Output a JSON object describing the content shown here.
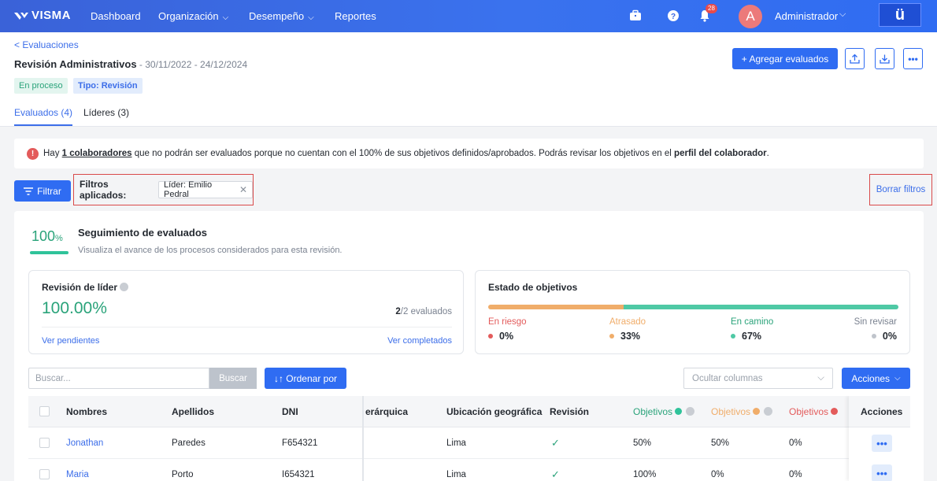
{
  "nav": {
    "brand": "VISMA",
    "items": [
      {
        "label": "Dashboard"
      },
      {
        "label": "Organización"
      },
      {
        "label": "Desempeño"
      },
      {
        "label": "Reportes"
      }
    ],
    "notifications_count": "28",
    "avatar_initial": "A",
    "user_name": "Administrador",
    "app_button": "ü"
  },
  "header": {
    "back_link": "< Evaluaciones",
    "title": "Revisión Administrativos",
    "dates": " - 30/11/2022 - 24/12/2024",
    "status_tag": "En proceso",
    "type_tag": "Tipo: Revisión",
    "add_button": "+ Agregar evaluados",
    "tabs": [
      {
        "label": "Evaluados (4)",
        "active": true
      },
      {
        "label": "Líderes (3)",
        "active": false
      }
    ]
  },
  "alert": {
    "icon": "!",
    "text_1": "Hay ",
    "link": "1 colaboradores",
    "text_2": " que no podrán ser evaluados porque no cuentan con el 100% de sus objetivos definidos/aprobados. Podrás revisar los objetivos en el ",
    "bold": "perfil del colaborador",
    "text_3": "."
  },
  "filters": {
    "button": "Filtrar",
    "label": "Filtros aplicados:",
    "chip": "Líder: Emilio Pedral",
    "clear": "Borrar filtros"
  },
  "tracking": {
    "percent": "100",
    "percent_sign": "%",
    "title": "Seguimiento de evaluados",
    "subtitle": "Visualiza el avance de los procesos considerados para esta revisión."
  },
  "leader_review": {
    "title": "Revisión de líder",
    "value": "100.00%",
    "count_done": "2",
    "count_total": "/2 evaluados",
    "link_pending": "Ver pendientes",
    "link_completed": "Ver completados"
  },
  "objectives_status": {
    "title": "Estado de objetivos",
    "segments": [
      {
        "name": "En riesgo",
        "value": "0%",
        "fraction": 0,
        "color": "#e35b5b"
      },
      {
        "name": "Atrasado",
        "value": "33%",
        "fraction": 0.33,
        "color": "#f0ad6a"
      },
      {
        "name": "En camino",
        "value": "67%",
        "fraction": 0.67,
        "color": "#4fc9a5"
      },
      {
        "name": "Sin revisar",
        "value": "0%",
        "fraction": 0,
        "color": "#bfc4cb"
      }
    ]
  },
  "toolbar": {
    "search_placeholder": "Buscar...",
    "search_button": "Buscar",
    "sort_button": "↓↑ Ordenar por",
    "hide_columns": "Ocultar columnas",
    "actions_button": "Acciones"
  },
  "table": {
    "columns": {
      "names": "Nombres",
      "surnames": "Apellidos",
      "dni": "DNI",
      "hierarchy": "erárquica",
      "location": "Ubicación geográfica",
      "review": "Revisión",
      "obj_green": "Objetivos",
      "obj_orange": "Objetivos",
      "obj_red": "Objetivos",
      "actions": "Acciones"
    },
    "rows": [
      {
        "name": "Jonathan",
        "surname": "Paredes",
        "dni": "F654321",
        "location": "Lima",
        "review": "✓",
        "obj1": "50%",
        "obj2": "50%",
        "obj3": "0%"
      },
      {
        "name": "Maria",
        "surname": "Porto",
        "dni": "I654321",
        "location": "Lima",
        "review": "✓",
        "obj1": "100%",
        "obj2": "0%",
        "obj3": "0%"
      }
    ]
  }
}
